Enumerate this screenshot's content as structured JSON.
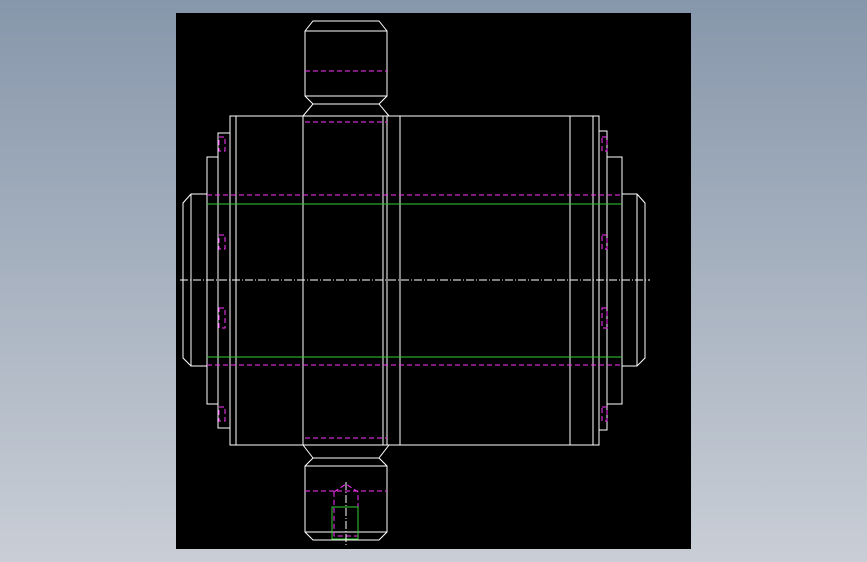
{
  "window": {
    "title": ""
  },
  "colors": {
    "background_top": "#8797ab",
    "background_bottom": "#c9ced6",
    "viewport_background": "#000000",
    "outline": "#ffffff",
    "hidden_line": "#ff33ff",
    "reference_line": "#33cc33",
    "centerline": "#ffffff"
  },
  "drawing": {
    "type": "cad-2d-orthographic",
    "subject": "gear-shaft-assembly",
    "line_styles": [
      "visible-outline",
      "hidden-dashed",
      "center-dashdot",
      "reference-solid"
    ]
  }
}
